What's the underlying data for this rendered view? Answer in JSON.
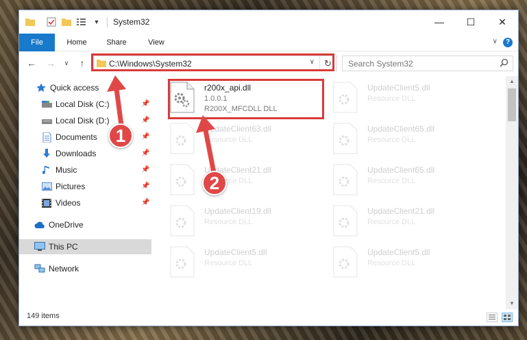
{
  "window": {
    "title": "System32",
    "controls": {
      "minimize": "—",
      "maximize": "☐",
      "close": "✕"
    }
  },
  "ribbon": {
    "tabs": [
      "File",
      "Home",
      "Share",
      "View"
    ],
    "help": "?"
  },
  "address": {
    "path": "C:\\Windows\\System32",
    "search_placeholder": "Search System32"
  },
  "sidebar": {
    "quick_access": "Quick access",
    "pinned": [
      {
        "label": "Local Disk (C:)",
        "icon": "drive-icon"
      },
      {
        "label": "Local Disk (D:)",
        "icon": "drive-icon"
      },
      {
        "label": "Documents",
        "icon": "documents-icon"
      },
      {
        "label": "Downloads",
        "icon": "downloads-icon"
      },
      {
        "label": "Music",
        "icon": "music-icon"
      },
      {
        "label": "Pictures",
        "icon": "pictures-icon"
      },
      {
        "label": "Videos",
        "icon": "videos-icon"
      }
    ],
    "onedrive": "OneDrive",
    "this_pc": "This PC",
    "network": "Network"
  },
  "files": {
    "highlighted": {
      "name": "r200x_api.dll",
      "version": "1.0.0.1",
      "description": "R200X_MFCDLL DLL"
    },
    "left_column": [
      {
        "name": "UpdateClient63.dll",
        "description": "Resource DLL"
      },
      {
        "name": "UpdateClient21.dll",
        "description": "Resource DLL"
      },
      {
        "name": "UpdateClient19.dll",
        "description": "Resource DLL"
      },
      {
        "name": "UpdateClient5.dll",
        "description": "Resource DLL"
      }
    ],
    "right_column": [
      {
        "name": "UpdateClient5.dll",
        "description": "Resource DLL"
      },
      {
        "name": "UpdateClient65.dll",
        "description": "Resource DLL"
      },
      {
        "name": "UpdateClient65.dll",
        "description": "Resource DLL"
      },
      {
        "name": "UpdateClient21.dll",
        "description": "Resource DLL"
      },
      {
        "name": "UpdateClient5.dll",
        "description": "Resource DLL"
      }
    ]
  },
  "status": {
    "item_count": "149 items"
  },
  "annotations": {
    "callout_1": "1",
    "callout_2": "2",
    "accent_color": "#e04848"
  },
  "colors": {
    "file_tab": "#1979ca",
    "highlight": "#d93a3a"
  }
}
